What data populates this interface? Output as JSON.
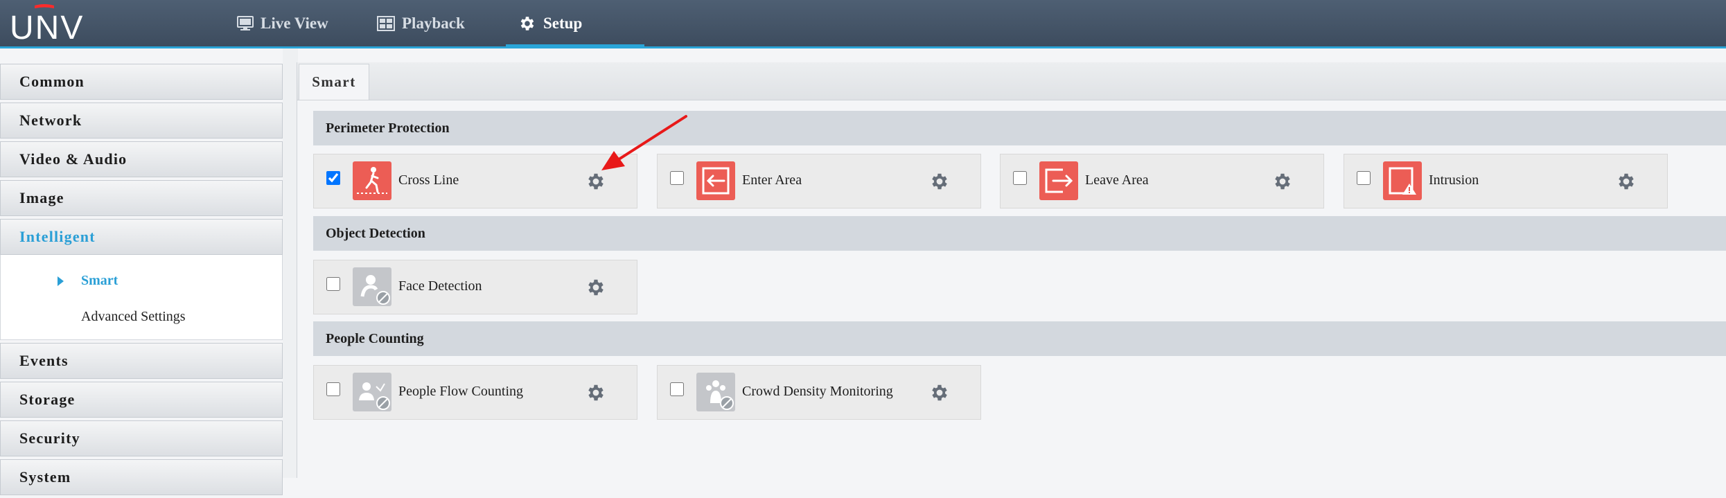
{
  "header": {
    "brand": "UNV",
    "tabs": [
      {
        "label": "Live View",
        "icon": "monitor-icon"
      },
      {
        "label": "Playback",
        "icon": "playback-icon"
      },
      {
        "label": "Setup",
        "icon": "gear-icon",
        "active": true
      }
    ]
  },
  "sidebar": {
    "items": [
      {
        "label": "Common"
      },
      {
        "label": "Network"
      },
      {
        "label": "Video & Audio"
      },
      {
        "label": "Image"
      },
      {
        "label": "Intelligent",
        "active": true
      },
      {
        "label": "Events"
      },
      {
        "label": "Storage"
      },
      {
        "label": "Security"
      },
      {
        "label": "System"
      }
    ],
    "submenu": [
      {
        "label": "Smart",
        "active": true
      },
      {
        "label": "Advanced Settings"
      }
    ]
  },
  "main": {
    "tab_label": "Smart",
    "sections": [
      {
        "title": "Perimeter Protection",
        "items": [
          {
            "label": "Cross Line",
            "checked": true,
            "icon": "cross-line-icon",
            "enabled": true
          },
          {
            "label": "Enter Area",
            "checked": false,
            "icon": "enter-area-icon",
            "enabled": true
          },
          {
            "label": "Leave Area",
            "checked": false,
            "icon": "leave-area-icon",
            "enabled": true
          },
          {
            "label": "Intrusion",
            "checked": false,
            "icon": "intrusion-icon",
            "enabled": true
          }
        ]
      },
      {
        "title": "Object Detection",
        "items": [
          {
            "label": "Face Detection",
            "checked": false,
            "icon": "face-detection-icon",
            "enabled": false
          }
        ]
      },
      {
        "title": "People Counting",
        "items": [
          {
            "label": "People Flow Counting",
            "checked": false,
            "icon": "people-flow-icon",
            "enabled": false
          },
          {
            "label": "Crowd Density Monitoring",
            "checked": false,
            "icon": "crowd-density-icon",
            "enabled": false
          }
        ]
      }
    ]
  },
  "colors": {
    "header_bg": "#45566a",
    "accent": "#2aa5d8",
    "icon_red": "#ec5d55",
    "icon_gray": "#c4c6ca",
    "annotation_arrow": "#e81919"
  }
}
